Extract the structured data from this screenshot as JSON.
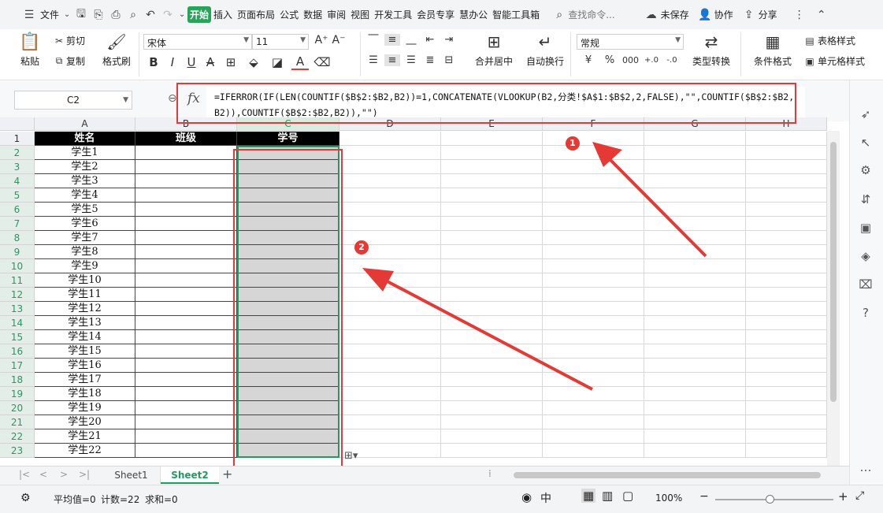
{
  "menubar": {
    "file_label": "文件",
    "tabs": [
      "开始",
      "插入",
      "页面布局",
      "公式",
      "数据",
      "审阅",
      "视图",
      "开发工具",
      "会员专享",
      "慧办公",
      "智能工具箱"
    ],
    "search_placeholder": "查找命令...",
    "unsaved": "未保存",
    "collab": "协作",
    "share": "分享"
  },
  "ribbon": {
    "paste": "粘贴",
    "cut": "剪切",
    "copy": "复制",
    "format_painter": "格式刷",
    "font_name": "宋体",
    "font_size": "11",
    "merge_center": "合并居中",
    "wrap_text": "自动换行",
    "number_format": "常规",
    "type_convert": "类型转换",
    "cond_format": "条件格式",
    "table_style": "表格样式",
    "cell_style": "单元格样式"
  },
  "formula_bar": {
    "name_box": "C2",
    "fx": "fx",
    "formula": "=IFERROR(IF(LEN(COUNTIF($B$2:$B2,B2))=1,CONCATENATE(VLOOKUP(B2,分类!$A$1:$B$2,2,FALSE),\"\",COUNTIF($B$2:$B2,B2)),COUNTIF($B$2:$B2,B2)),\"\")"
  },
  "grid": {
    "columns": [
      "A",
      "B",
      "C",
      "D",
      "E",
      "F",
      "G",
      "H"
    ],
    "rows": [
      "1",
      "2",
      "3",
      "4",
      "5",
      "6",
      "7",
      "8",
      "9",
      "10",
      "11",
      "12",
      "13",
      "14",
      "15",
      "16",
      "17",
      "18",
      "19",
      "20",
      "21",
      "22",
      "23"
    ],
    "header": [
      "姓名",
      "班级",
      "学号"
    ],
    "names": [
      "学生1",
      "学生2",
      "学生3",
      "学生4",
      "学生5",
      "学生6",
      "学生7",
      "学生8",
      "学生9",
      "学生10",
      "学生11",
      "学生12",
      "学生13",
      "学生14",
      "学生15",
      "学生16",
      "学生17",
      "学生18",
      "学生19",
      "学生20",
      "学生21",
      "学生22"
    ]
  },
  "annotations": {
    "badge1": "1",
    "badge2": "2"
  },
  "sheets": {
    "tabs": [
      "Sheet1",
      "Sheet2"
    ],
    "active": "Sheet2"
  },
  "statusbar": {
    "average": "平均值=0",
    "count": "计数=22",
    "sum": "求和=0",
    "zoom": "100%"
  },
  "colors": {
    "accent": "#29a35a",
    "selection": "#1f9d5e",
    "annotation": "#e53935"
  }
}
